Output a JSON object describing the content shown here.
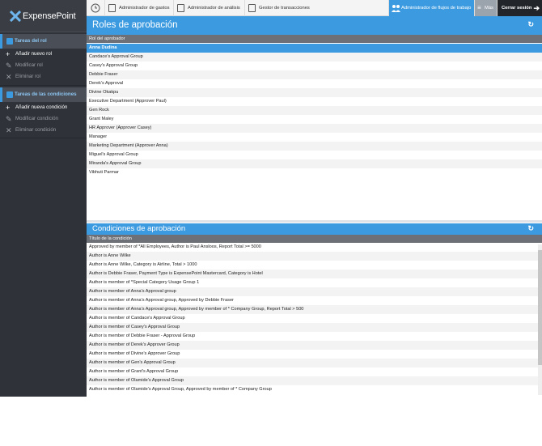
{
  "brand": {
    "name": "ExpensePoint",
    "mark": "X"
  },
  "sidebar": {
    "roles_header": "Tareas del rol",
    "roles_items": [
      {
        "label": "Añadir nuevo rol",
        "icon": "+",
        "disabled": false
      },
      {
        "label": "Modificar rol",
        "icon": "✎",
        "disabled": true
      },
      {
        "label": "Eliminar rol",
        "icon": "✕",
        "disabled": true
      }
    ],
    "conditions_header": "Tareas de las condiciones",
    "conditions_items": [
      {
        "label": "Añadir nueva condición",
        "icon": "+",
        "disabled": false
      },
      {
        "label": "Modificar condición",
        "icon": "✎",
        "disabled": true
      },
      {
        "label": "Eliminar condición",
        "icon": "✕",
        "disabled": true
      }
    ]
  },
  "topnav": {
    "items": [
      {
        "label": "",
        "icon": "clock-icon"
      },
      {
        "label": "Administrador de gastos",
        "icon": "expense-icon"
      },
      {
        "label": "Administrador de análisis",
        "icon": "analysis-icon"
      },
      {
        "label": "Gestor de transacciones",
        "icon": "transaction-icon"
      },
      {
        "label": "Administrador de flujos de trabajo",
        "icon": "workflow-icon"
      },
      {
        "label": "Más",
        "icon": "menu-icon"
      },
      {
        "label": "Cerrar sesión",
        "icon": "logout-icon"
      }
    ]
  },
  "roles": {
    "title": "Roles de aprobación",
    "column": "Rol del aprobador",
    "selected": "Anna Dudina",
    "rows": [
      "Candace's Approval Group",
      "Casey's Approval Group",
      "Debbie Fraser",
      "Derek's Approval",
      "Divine Okakpu",
      "Executive Department (Approver Paul)",
      "Gen Rock",
      "Grant Maley",
      "HR Approver (Approver Casey)",
      "Manager",
      "Marketing Department (Approver Anna)",
      "Miguel's Approval Group",
      "Miranda's Approval Group",
      "Vibhuti Parmar"
    ]
  },
  "conditions": {
    "title": "Condiciones de aprobación",
    "column": "Título de la condición",
    "rows": [
      "Approved by member of *All Employees, Author is Paul Ansloos, Report Total >= 5000",
      "Author is Anne Wilke",
      "Author is Anne Wilke, Category is Airline, Total > 1000",
      "Author is Debbie Fraser, Payment Type is ExpensePoint Mastercard, Category is Hotel",
      "Author is member of *Special Category Usage Group 1",
      "Author is member of Anna's Approval group",
      "Author is member of Anna's Approval group, Approved by Debbie Fraser",
      "Author is member of Anna's Approval group, Approved by member of * Company Group, Report Total > 500",
      "Author is member of Candace's Approval Group",
      "Author is member of Casey's Approval Group",
      "Author is member of Debbie Fraser - Approval Group",
      "Author is member of Derek's Approver Group",
      "Author is member of Divine's Approver Group",
      "Author is member of Gen's Approval Group",
      "Author is member of Grant's Approval Group",
      "Author is member of Olamide's Approval Group",
      "Author is member of Olamide's Approval Group, Approved by member of * Company Group"
    ]
  }
}
